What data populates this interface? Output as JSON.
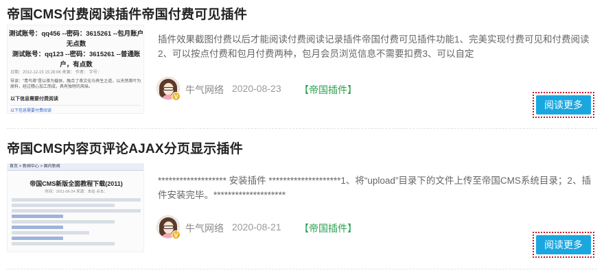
{
  "articles": [
    {
      "title": "帝国CMS付费阅读插件帝国付费可见插件",
      "thumbnail": {
        "line1": "测试账号：qq456 --密码：3615261 --包月账户",
        "line2": "无点数",
        "line3": "测试账号：qq123 --密码：3615261 --普通账",
        "line4": "户，有点数",
        "meta": "日期：2012-12-15 15:28:06  来源：    作者：  字号：",
        "body": "导读：\"青鸟茶\"是以茶为载体，融合了茶文化与养生之道，以天然茶叶为原料，经过精心加工而成，具有独特的风味。",
        "link": "以下信息需要付费阅读",
        "sub": "以下信息需要付费阅读"
      },
      "summary": "插件效果截图付费以后才能阅读付费阅读记录插件帝国付费可见插件功能1、完美实现付费可见和付费阅读2、可以按点付费和包月付费两种，包月会员浏览信息不需要扣费3、可以自定",
      "author": "牛气网络",
      "date": "2020-08-23",
      "category_open": "【",
      "category": "帝国插件",
      "category_close": "】",
      "read_more": "阅读更多"
    },
    {
      "title": "帝国CMS内容页评论AJAX分页显示插件",
      "thumbnail": {
        "bar": "首页 > 新闻中心 > 国内新闻",
        "title": "帝国CMS新版全面教程下载(2011)",
        "meta": "时间：2011-06-24 来源：本站 点击："
      },
      "summary": "******************* 安装插件 ********************1、将“upload”目录下的文件上传至帝国CMS系统目录；2、插件安装完毕。********************",
      "author": "牛气网络",
      "date": "2020-08-21",
      "category_open": "【",
      "category": "帝国插件",
      "category_close": "】",
      "read_more": "阅读更多"
    }
  ],
  "badge_letter": "V",
  "colors": {
    "accent_button": "#1aa7e0",
    "category_green": "#2aa14f",
    "highlight_red": "#d0101a"
  }
}
